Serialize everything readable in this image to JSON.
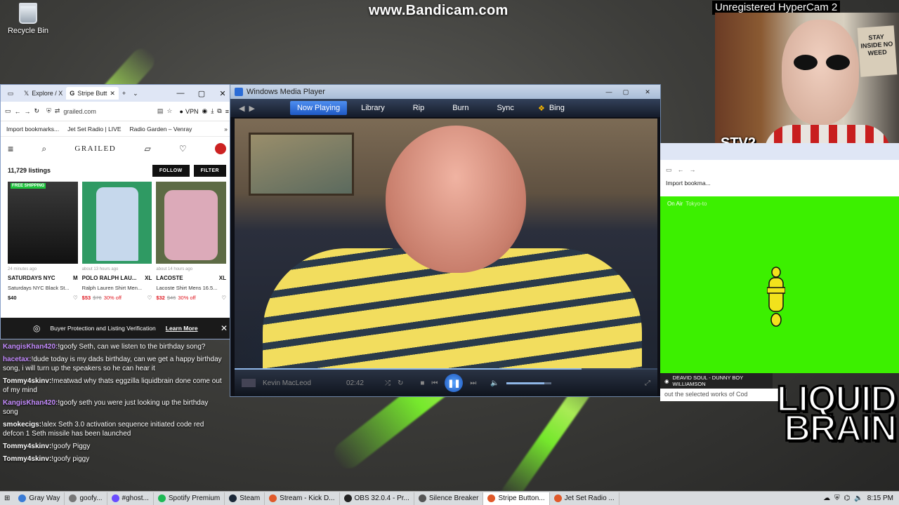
{
  "desktop": {
    "recycle_bin_label": "Recycle Bin",
    "watermark": "www.Bandicam.com",
    "hypercam_label": "Unregistered HyperCam 2"
  },
  "browser": {
    "tabs": [
      {
        "label": "Explore / X"
      },
      {
        "label": "Stripe Butt"
      }
    ],
    "url": "grailed.com",
    "vpn_label": "VPN",
    "bookmarks": [
      "Import bookmarks...",
      "Jet Set Radio | LIVE",
      "Radio Garden – Venray"
    ],
    "site_logo": "GRAILED",
    "listings_count": "11,729 listings",
    "follow_label": "FOLLOW",
    "filter_label": "FILTER",
    "products": [
      {
        "badge": "FREE SHIPPING",
        "time": "24 minutes ago",
        "brand": "SATURDAYS NYC",
        "size": "M",
        "desc": "Saturdays NYC Black St...",
        "price": "$40",
        "old_price": "",
        "discount": "",
        "img_colors": [
          "#2a2a2a",
          "#6b6b6b"
        ]
      },
      {
        "badge": "",
        "time": "about 13 hours ago",
        "brand": "POLO RALPH LAU...",
        "size": "XL",
        "desc": "Ralph Lauren Shirt Men...",
        "price": "$53",
        "old_price": "$76",
        "discount": "30% off",
        "img_colors": [
          "#b7cfe6",
          "#3ca06a"
        ]
      },
      {
        "badge": "",
        "time": "about 14 hours ago",
        "brand": "LACOSTE",
        "size": "XL",
        "desc": "Lacoste Shirt Mens 16.5...",
        "price": "$32",
        "old_price": "$46",
        "discount": "30% off",
        "img_colors": [
          "#d9a7b6",
          "#5a6a40"
        ]
      }
    ],
    "protection_text": "Buyer Protection and Listing Verification",
    "learn_more_label": "Learn More"
  },
  "wmp": {
    "title": "Windows Media Player",
    "tabs": [
      "Now Playing",
      "Library",
      "Rip",
      "Burn",
      "Sync",
      "Bing"
    ],
    "active_tab": "Now Playing",
    "artist": "Kevin MacLeod",
    "time": "02:42",
    "progress": 0.82,
    "volume": 0.85
  },
  "chat": [
    {
      "user": "KangisKhan420:",
      "text": "!goofy Seth, can we listen to the birthday song?",
      "color": "#c58cff"
    },
    {
      "user": "hacetax:",
      "text": "!dude today is my dads birthday, can we get a happy birthday song, i will turn up the speakers so he can hear it",
      "color": "#c58cff"
    },
    {
      "user": "Tommy4skinv:",
      "text": "!meatwad why thats eggzilla liquidbrain done come out of my mind",
      "color": "#ffffff"
    },
    {
      "user": "KangisKhan420:",
      "text": "!goofy seth you were just looking up the birthday song",
      "color": "#c58cff"
    },
    {
      "user": "smokecigs:",
      "text": "!alex Seth 3.0 activation sequence initiated code red defcon 1 Seth missile has been launched",
      "color": "#ffffff"
    },
    {
      "user": "Tommy4skinv:",
      "text": "!goofy Piggy",
      "color": "#ffffff"
    },
    {
      "user": "Tommy4skinv:",
      "text": "!goofy piggy",
      "color": "#ffffff"
    }
  ],
  "webcam": {
    "overlay_text": "STV2",
    "poster_text": "STAY INSIDE NO WEED"
  },
  "right_browser": {
    "bookmark": "Import bookma...",
    "on_air_label": "On Air",
    "on_air_sub": "Tokyo-to",
    "now_playing": "DEAVID SOUL - DUNNY BOY WILLIAMSON",
    "link_text": "out the selected works of Cod"
  },
  "logo": {
    "line1": "LIQUID",
    "line2": "BRAIN"
  },
  "taskbar": {
    "items": [
      {
        "label": "Gray Way",
        "color": "#3a7bd5"
      },
      {
        "label": "goofy...",
        "color": "#777"
      },
      {
        "label": "#ghost...",
        "color": "#6a4cff"
      },
      {
        "label": "Spotify Premium",
        "color": "#1db954"
      },
      {
        "label": "Steam",
        "color": "#1b2838"
      },
      {
        "label": "Stream - Kick D...",
        "color": "#e0592a"
      },
      {
        "label": "OBS 32.0.4 - Pr...",
        "color": "#222"
      },
      {
        "label": "Silence Breaker",
        "color": "#555"
      },
      {
        "label": "Stripe Button...",
        "color": "#e0592a"
      },
      {
        "label": "Jet Set Radio ...",
        "color": "#e0592a"
      }
    ],
    "active_item": "Stripe Button...",
    "clock": "8:15 PM"
  }
}
